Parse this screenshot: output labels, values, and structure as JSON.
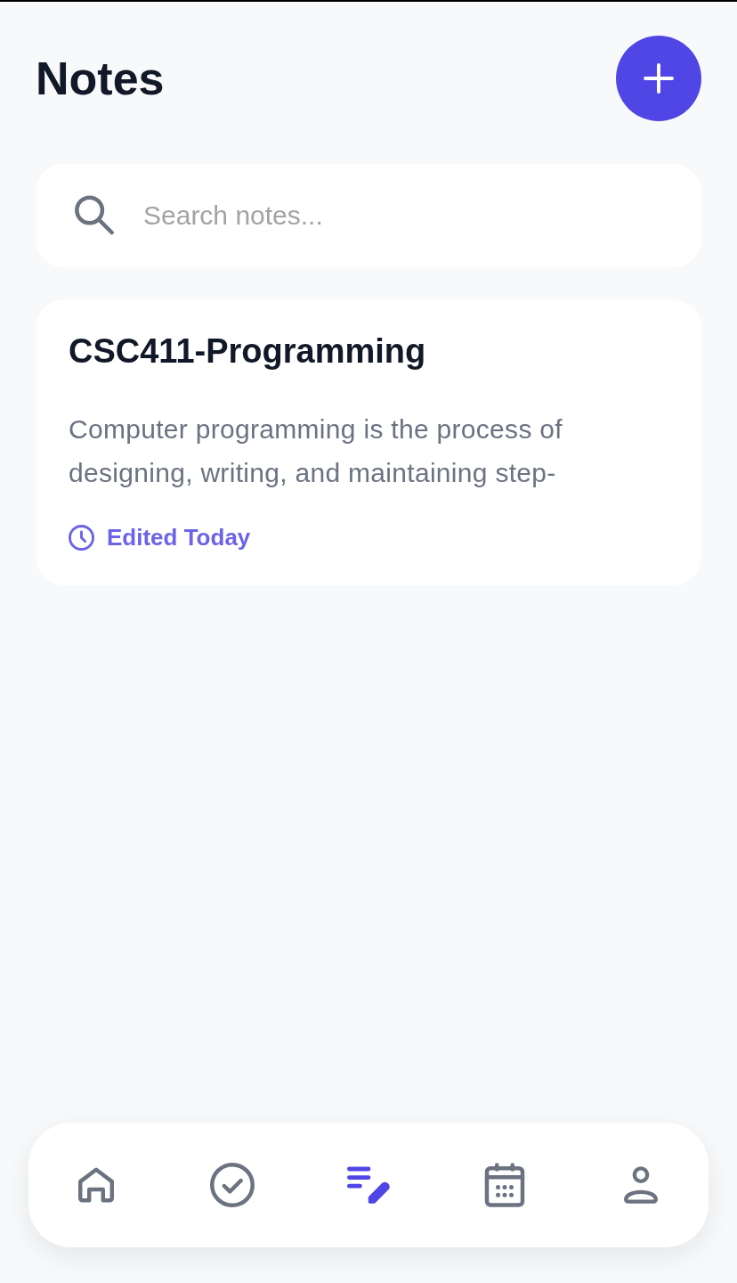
{
  "header": {
    "title": "Notes"
  },
  "search": {
    "placeholder": "Search notes..."
  },
  "notes": [
    {
      "title": "CSC411-Programming",
      "body": "Computer programming is the process of designing, writing, and maintaining step-",
      "edited": "Edited Today"
    }
  ],
  "nav": [
    {
      "selected": false
    },
    {
      "selected": false
    },
    {
      "selected": true
    },
    {
      "selected": false
    },
    {
      "selected": false
    }
  ]
}
